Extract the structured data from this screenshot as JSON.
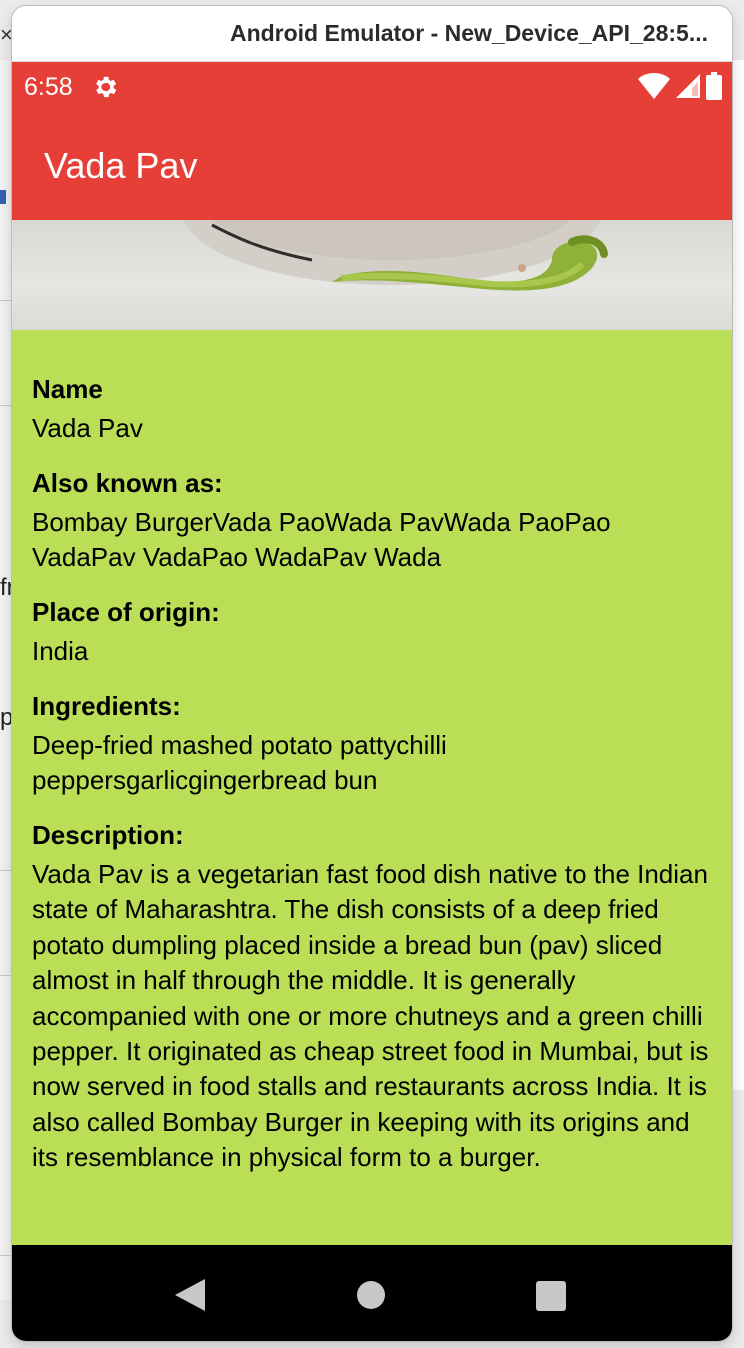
{
  "window": {
    "title": "Android Emulator - New_Device_API_28:5..."
  },
  "status_bar": {
    "time": "6:58",
    "icons": [
      "settings-gear-icon",
      "wifi-icon",
      "cell-signal-icon",
      "battery-icon"
    ]
  },
  "app_bar": {
    "title": "Vada Pav"
  },
  "details": {
    "name_label": "Name",
    "name_value": "Vada Pav",
    "aka_label": "Also known as:",
    "aka_value": "Bombay BurgerVada PaoWada PavWada PaoPao VadaPav VadaPao WadaPav Wada",
    "origin_label": "Place of origin:",
    "origin_value": "India",
    "ingredients_label": "Ingredients:",
    "ingredients_value": "Deep-fried mashed potato pattychilli peppersgarlicgingerbread bun",
    "description_label": "Description:",
    "description_value": "Vada Pav is a vegetarian fast food dish native to the Indian state of Maharashtra. The dish consists of a deep fried potato dumpling placed inside a bread bun (pav) sliced almost in half through the middle. It is generally accompanied with one or more chutneys and a green chilli pepper. It originated as cheap street food in Mumbai, but is now served in food stalls and restaurants across India. It is also called Bombay Burger in keeping with its origins and its resemblance in physical form to a burger."
  },
  "background_fragments": {
    "close": "×",
    "frag1": "fr",
    "frag2": "p"
  },
  "colors": {
    "toolbar": "#e53f37",
    "content_background": "#bade55",
    "nav_bar": "#000000"
  }
}
